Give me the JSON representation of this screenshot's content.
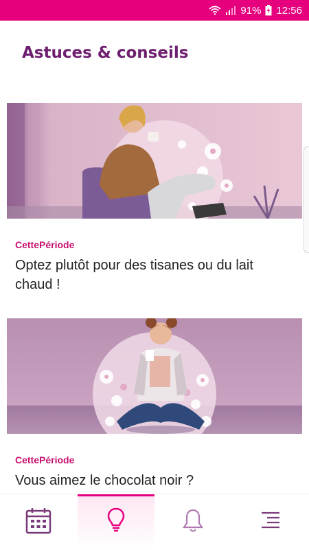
{
  "status_bar": {
    "battery": "91%",
    "time": "12:56"
  },
  "header": {
    "title": "Astuces & conseils"
  },
  "cards": [
    {
      "category": "CettePériode",
      "title": "Optez plutôt pour des tisanes ou du lait chaud !"
    },
    {
      "category": "CettePériode",
      "title": "Vous aimez le chocolat noir ?"
    }
  ],
  "bottom_nav": {
    "items": [
      {
        "icon": "calendar-icon"
      },
      {
        "icon": "lightbulb-icon",
        "active": true
      },
      {
        "icon": "bell-icon"
      },
      {
        "icon": "menu-icon"
      }
    ]
  },
  "colors": {
    "brand": "#e6007e",
    "title": "#6e1e6e",
    "category": "#c8106e",
    "icon": "#7a3a7a"
  }
}
